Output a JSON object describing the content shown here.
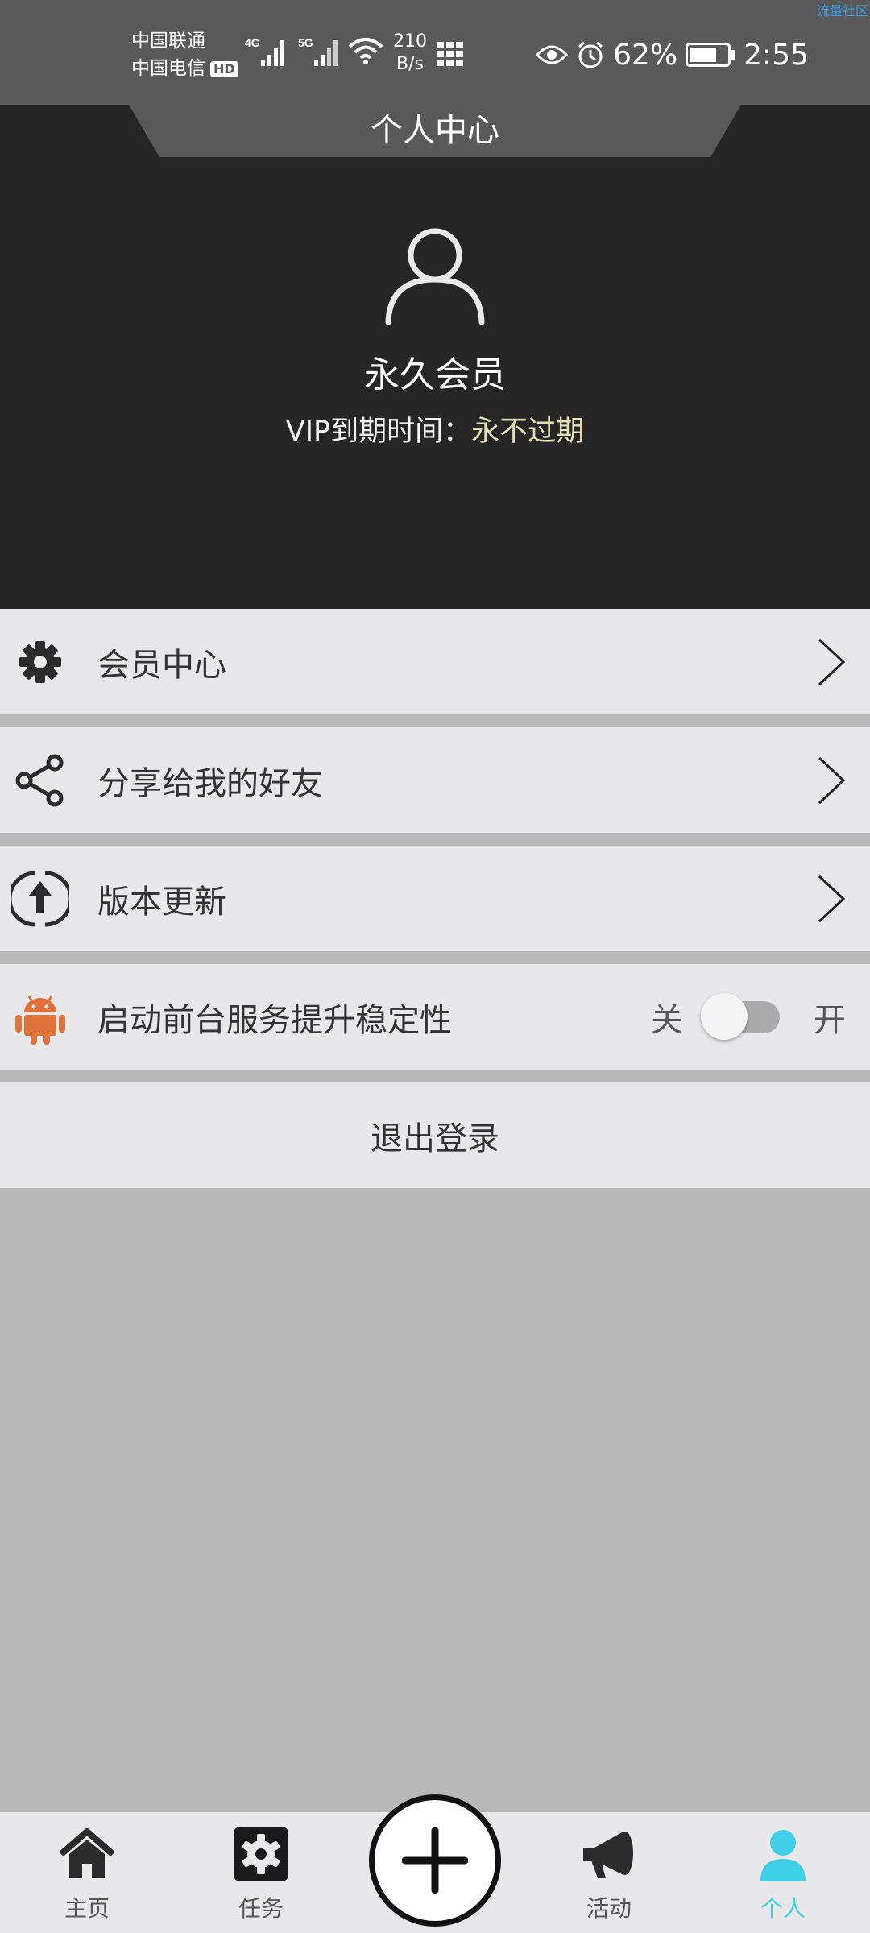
{
  "status_bar": {
    "carrier1": "中国联通",
    "carrier2": "中国电信",
    "hd_badge": "HD",
    "net1": "4G",
    "net2": "5G",
    "speed_value": "210",
    "speed_unit": "B/s",
    "battery": "62%",
    "time": "2:55",
    "brand_corner": "流量社区"
  },
  "header": {
    "title": "个人中心",
    "member_name": "永久会员",
    "vip_label": "VIP到期时间：",
    "vip_expiry": "永不过期"
  },
  "menu": {
    "member_center": "会员中心",
    "share": "分享给我的好友",
    "update": "版本更新",
    "foreground_service": "启动前台服务提升稳定性",
    "toggle_off": "关",
    "toggle_on": "开",
    "toggle_state": "off",
    "logout": "退出登录"
  },
  "nav": {
    "home": "主页",
    "tasks": "任务",
    "activity": "活动",
    "profile": "个人",
    "active": "profile"
  },
  "colors": {
    "accent": "#3fd0e8",
    "header_bg": "#262626",
    "android_icon": "#e0723c",
    "expiry_text": "#e7e0b4"
  }
}
